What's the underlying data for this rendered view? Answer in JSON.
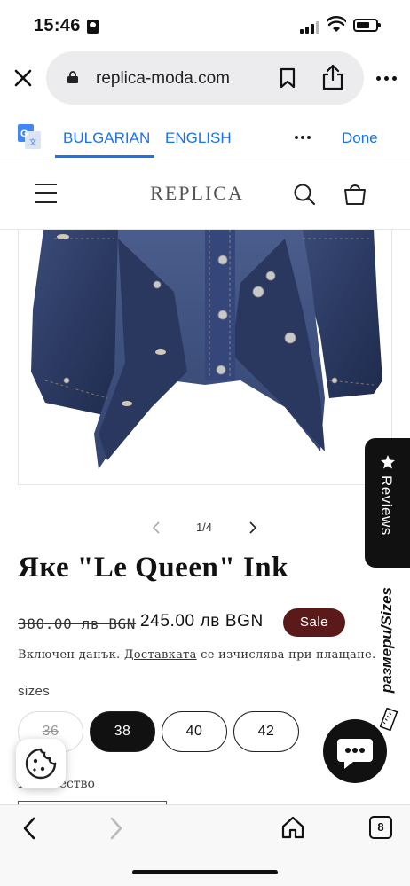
{
  "status_bar": {
    "time": "15:46"
  },
  "browser": {
    "url": "replica-moda.com",
    "tab_count": "8"
  },
  "translate_bar": {
    "lang_source": "BULGARIAN",
    "lang_target": "ENGLISH",
    "done_label": "Done"
  },
  "site": {
    "logo": "REPLICA"
  },
  "gallery": {
    "counter": "1/4"
  },
  "reviews_tab": {
    "label": "Reviews"
  },
  "sizes_tab": {
    "label": "размери/Sizes"
  },
  "product": {
    "title": "Яке \"Le Queen\" Ink",
    "price_old": "380.00 лв BGN",
    "price_new": "245.00 лв BGN",
    "sale_badge": "Sale",
    "tax_prefix": "Включен данък.",
    "tax_link": "Доставката",
    "tax_suffix": "се изчислява при плащане.",
    "sizes_label": "sizes",
    "sizes": [
      "36",
      "38",
      "40",
      "42"
    ],
    "selected_size": "38",
    "quantity_label": "Количество"
  },
  "colors": {
    "sale_badge": "#5a1a1a",
    "translate_accent": "#1a73e8",
    "denim": "#2f3e63"
  }
}
